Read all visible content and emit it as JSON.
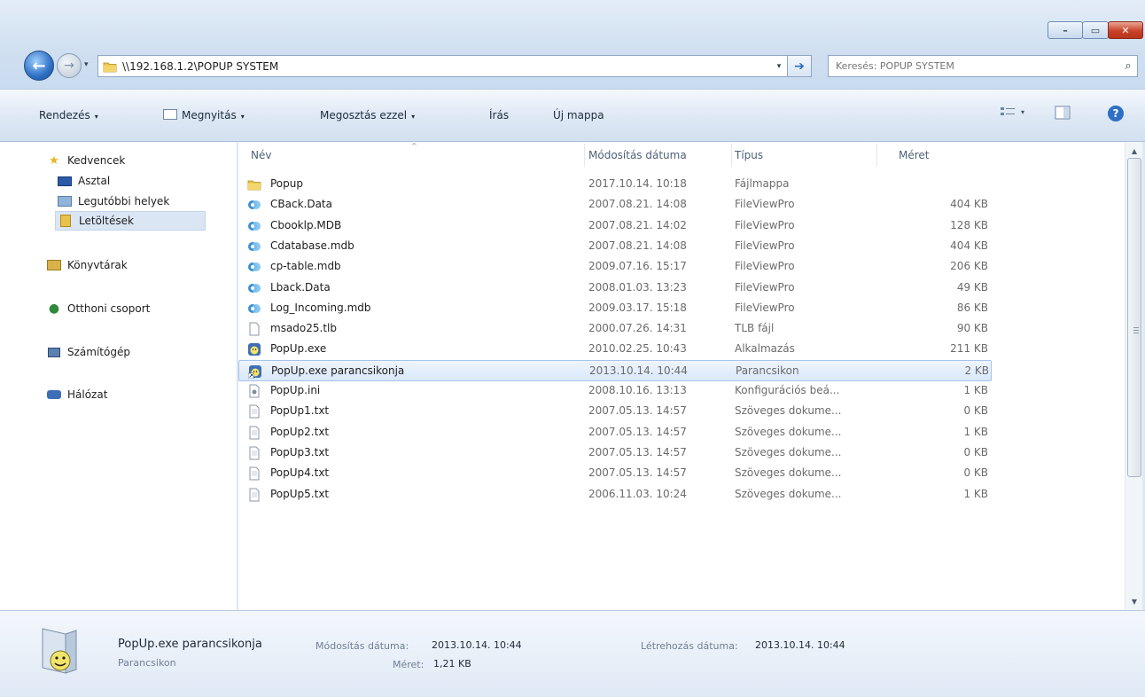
{
  "window": {
    "caption_min": "–",
    "caption_max": "▭",
    "caption_close": "✕"
  },
  "address": {
    "path": "\\\\192.168.1.2\\POPUP SYSTEM",
    "dropdown": "▾",
    "go": "➔"
  },
  "search": {
    "placeholder": "Keresés: POPUP SYSTEM",
    "icon": "⌕"
  },
  "commandbar": {
    "organize": "Rendezés",
    "open": "Megnyitás",
    "share": "Megosztás ezzel",
    "burn": "Írás",
    "new_folder": "Új mappa",
    "arrow": "▾",
    "views_arrow": "▾",
    "help": "?"
  },
  "navpane": {
    "items": [
      {
        "label": "Kedvencek",
        "icon": "star-icon"
      },
      {
        "label": "Asztal",
        "icon": "desktop-icon"
      },
      {
        "label": "Legutóbbi helyek",
        "icon": "recent-places-icon"
      },
      {
        "label": "Letöltések",
        "icon": "downloads-folder-icon"
      },
      {
        "label": "Könyvtárak",
        "icon": "libraries-icon"
      },
      {
        "label": "Otthoni csoport",
        "icon": "homegroup-icon"
      },
      {
        "label": "Számítógép",
        "icon": "computer-icon"
      },
      {
        "label": "Hálózat",
        "icon": "network-icon"
      }
    ]
  },
  "columns": {
    "name": "Név",
    "date": "Módosítás dátuma",
    "type": "Típus",
    "size": "Méret",
    "sort_indicator": "^"
  },
  "files": [
    {
      "name": "Popup",
      "date": "2017.10.14. 10:18",
      "type": "Fájlmappa",
      "size": "",
      "icon": "folder-icon"
    },
    {
      "name": "CBack.Data",
      "date": "2007.08.21. 14:08",
      "type": "FileViewPro",
      "size": "404 KB",
      "icon": "fileviewpro-icon"
    },
    {
      "name": "Cbooklp.MDB",
      "date": "2007.08.21. 14:02",
      "type": "FileViewPro",
      "size": "128 KB",
      "icon": "fileviewpro-icon"
    },
    {
      "name": "Cdatabase.mdb",
      "date": "2007.08.21. 14:08",
      "type": "FileViewPro",
      "size": "404 KB",
      "icon": "fileviewpro-icon"
    },
    {
      "name": "cp-table.mdb",
      "date": "2009.07.16. 15:17",
      "type": "FileViewPro",
      "size": "206 KB",
      "icon": "fileviewpro-icon"
    },
    {
      "name": "Lback.Data",
      "date": "2008.01.03. 13:23",
      "type": "FileViewPro",
      "size": "49 KB",
      "icon": "fileviewpro-icon"
    },
    {
      "name": "Log_Incoming.mdb",
      "date": "2009.03.17. 15:18",
      "type": "FileViewPro",
      "size": "86 KB",
      "icon": "fileviewpro-icon"
    },
    {
      "name": "msado25.tlb",
      "date": "2000.07.26. 14:31",
      "type": "TLB fájl",
      "size": "90 KB",
      "icon": "blank-file-icon"
    },
    {
      "name": "PopUp.exe",
      "date": "2010.02.25. 10:43",
      "type": "Alkalmazás",
      "size": "211 KB",
      "icon": "exe-app-icon"
    },
    {
      "name": "PopUp.exe parancsikonja",
      "date": "2013.10.14. 10:44",
      "type": "Parancsikon",
      "size": "2 KB",
      "icon": "shortcut-icon"
    },
    {
      "name": "PopUp.ini",
      "date": "2008.10.16. 13:13",
      "type": "Konfigurációs beá...",
      "size": "1 KB",
      "icon": "ini-file-icon"
    },
    {
      "name": "PopUp1.txt",
      "date": "2007.05.13. 14:57",
      "type": "Szöveges dokume...",
      "size": "0 KB",
      "icon": "text-file-icon"
    },
    {
      "name": "PopUp2.txt",
      "date": "2007.05.13. 14:57",
      "type": "Szöveges dokume...",
      "size": "1 KB",
      "icon": "text-file-icon"
    },
    {
      "name": "PopUp3.txt",
      "date": "2007.05.13. 14:57",
      "type": "Szöveges dokume...",
      "size": "0 KB",
      "icon": "text-file-icon"
    },
    {
      "name": "PopUp4.txt",
      "date": "2007.05.13. 14:57",
      "type": "Szöveges dokume...",
      "size": "0 KB",
      "icon": "text-file-icon"
    },
    {
      "name": "PopUp5.txt",
      "date": "2006.11.03. 10:24",
      "type": "Szöveges dokume...",
      "size": "1 KB",
      "icon": "text-file-icon"
    }
  ],
  "selected_index": 9,
  "details": {
    "name": "PopUp.exe parancsikonja",
    "type": "Parancsikon",
    "modified_label": "Módosítás dátuma:",
    "modified_value": "2013.10.14. 10:44",
    "created_label": "Létrehozás dátuma:",
    "created_value": "2013.10.14. 10:44",
    "size_label": "Méret:",
    "size_value": "1,21 KB"
  },
  "colors": {
    "selection": "#d9e8fb",
    "chrome": "#dfe9f5",
    "accent": "#2f6fc4"
  }
}
